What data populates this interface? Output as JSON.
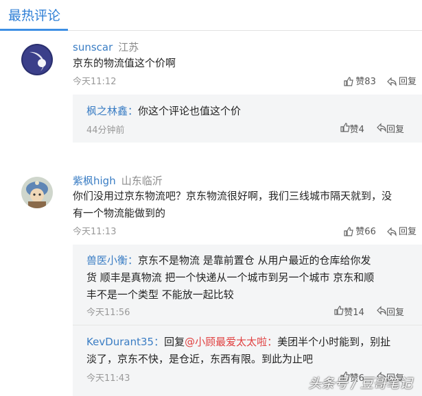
{
  "tabs": {
    "active_label": "最热评论"
  },
  "comments": [
    {
      "user": "sunscar",
      "location": "江苏",
      "text": "京东的物流值这个价啊",
      "time": "今天11:12",
      "like_label": "赞83",
      "reply_label": "回复",
      "replies": [
        {
          "name": "枫之林鑫：",
          "text": "你这个评论也值这个价",
          "time": "44分钟前",
          "like_label": "赞4",
          "reply_label": "回复"
        }
      ]
    },
    {
      "user": "紫枫high",
      "location": "山东临沂",
      "text_line1": "你们没用过京东物流吧？京东物流很好啊，我们三线城市隔天就到，没",
      "text_line2": "有一个物流能做到的",
      "time": "今天11:13",
      "like_label": "赞66",
      "reply_label": "回复",
      "replies": [
        {
          "name": "兽医小衡：",
          "text_line1": "京东不是物流 是靠前置仓 从用户最近的仓库给你发",
          "text_line2": "货 顺丰是真物流 把一个快递从一个城市到另一个城市  京东和顺",
          "text_line3": "丰不是一个类型 不能放一起比较",
          "time": "今天11:56",
          "like_label": "赞14",
          "reply_label": "回复"
        },
        {
          "name": "KevDurant35：",
          "reply_prefix": "回复",
          "at_user": "@小顾最爱太太啦：",
          "text_line1": "美团半个小时能到，别扯",
          "text_line2": "淡了，京东不快，是仓近，东西有限。到此为止吧",
          "time": "今天11:43",
          "like_label": "赞6",
          "reply_label": "回复"
        }
      ]
    }
  ],
  "watermark": "头条号 / 豆哥笔记"
}
